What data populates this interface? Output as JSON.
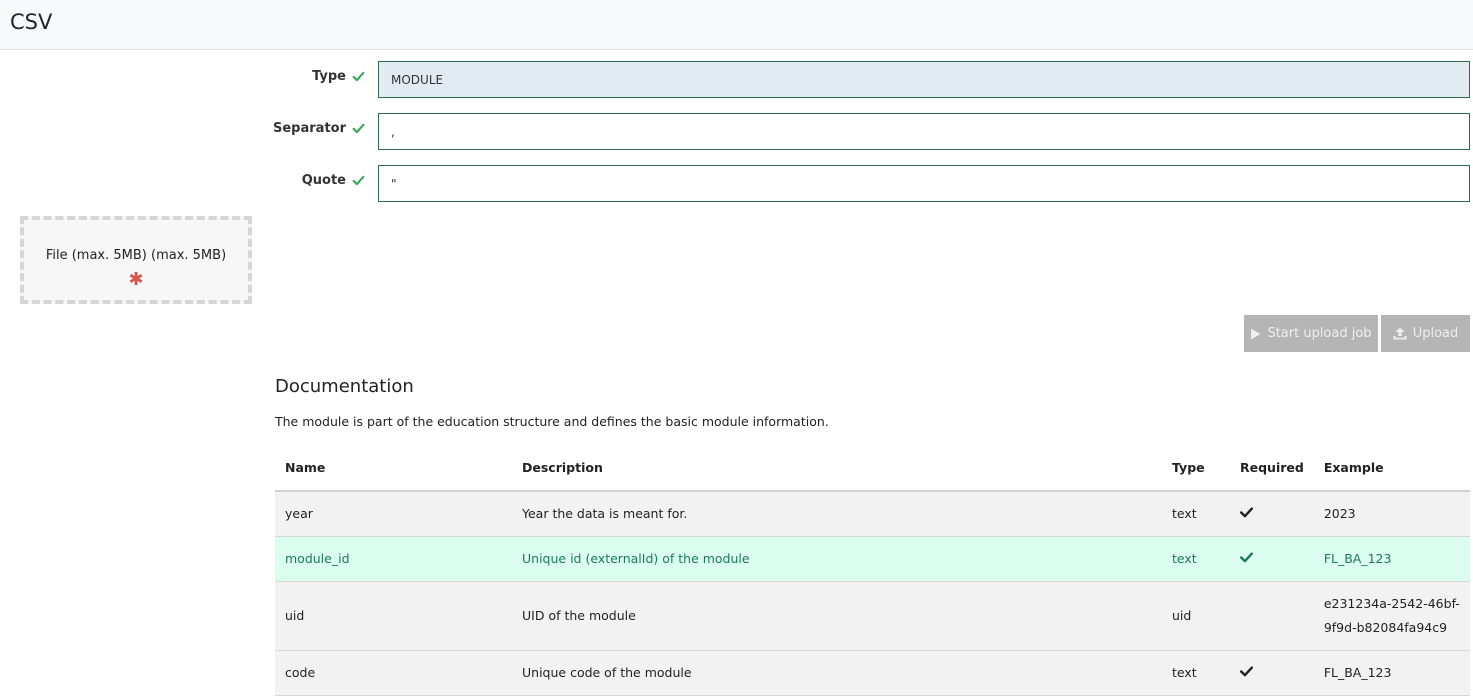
{
  "header": {
    "title": "CSV"
  },
  "form": {
    "type": {
      "label": "Type",
      "value": "MODULE"
    },
    "separator": {
      "label": "Separator",
      "value": ","
    },
    "quote": {
      "label": "Quote",
      "value": "\""
    }
  },
  "dropzone": {
    "label": "File (max. 5MB) (max. 5MB)",
    "required_mark": "✱"
  },
  "buttons": {
    "start_upload_job": "Start upload job",
    "upload": "Upload"
  },
  "documentation": {
    "title": "Documentation",
    "description": "The module is part of the education structure and defines the basic module information.",
    "columns": [
      "Name",
      "Description",
      "Type",
      "Required",
      "Example"
    ],
    "rows": [
      {
        "name": "year",
        "description": "Year the data is meant for.",
        "type": "text",
        "required": true,
        "example": "2023"
      },
      {
        "name": "module_id",
        "description": "Unique id (externalId) of the module",
        "type": "text",
        "required": true,
        "example": "FL_BA_123"
      },
      {
        "name": "uid",
        "description": "UID of the module",
        "type": "uid",
        "required": false,
        "example": "e231234a-2542-46bf-9f9d-b82084fa94c9"
      },
      {
        "name": "code",
        "description": "Unique code of the module",
        "type": "text",
        "required": true,
        "example": "FL_BA_123"
      }
    ]
  },
  "colors": {
    "valid_check": "#3aa655",
    "input_border": "#2d6a4f",
    "highlight_row": "#dafdf0",
    "required_star": "#d9534f",
    "button_disabled": "#b5b5b5"
  },
  "icons": {
    "valid": "check-icon",
    "play": "play-icon",
    "upload": "upload-icon",
    "required": "checkmark-icon"
  }
}
